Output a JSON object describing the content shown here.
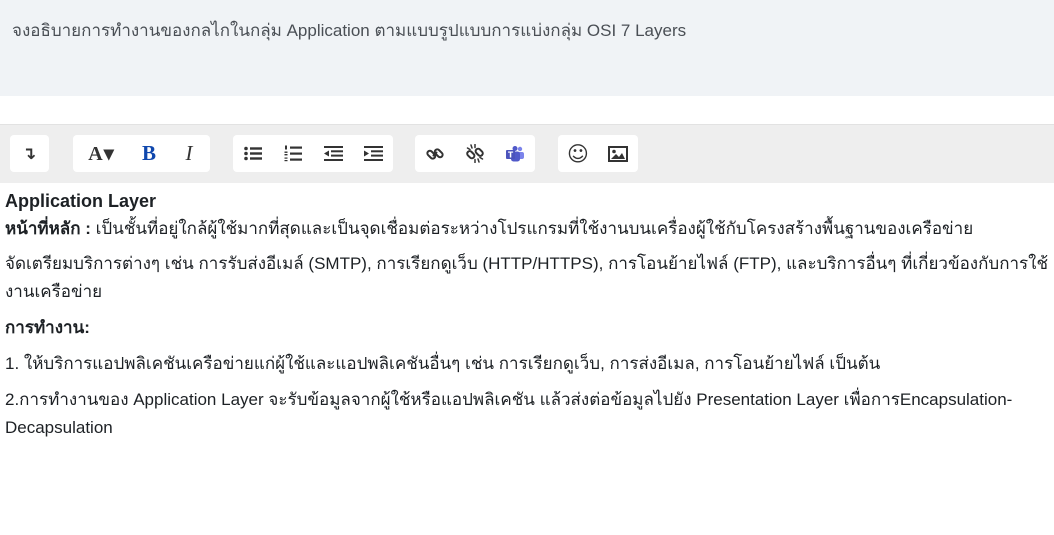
{
  "question": {
    "text": "จงอธิบายการทำงานของกลไกในกลุ่ม Application ตามแบบรูปแบบการแบ่งกลุ่ม OSI 7 Layers"
  },
  "toolbar": {
    "groups": [
      {
        "buttons": [
          {
            "icon": "collapse-arrow-icon",
            "glyph": "↴"
          }
        ]
      },
      {
        "buttons": [
          {
            "icon": "font-color-icon",
            "glyph": "A▾"
          },
          {
            "icon": "bold-icon",
            "glyph": "B"
          },
          {
            "icon": "italic-icon",
            "glyph": "I"
          }
        ]
      },
      {
        "buttons": [
          {
            "icon": "bullet-list-icon"
          },
          {
            "icon": "numbered-list-icon"
          },
          {
            "icon": "outdent-icon"
          },
          {
            "icon": "indent-icon"
          }
        ]
      },
      {
        "buttons": [
          {
            "icon": "link-icon"
          },
          {
            "icon": "unlink-icon"
          },
          {
            "icon": "teams-icon"
          }
        ]
      },
      {
        "buttons": [
          {
            "icon": "emoji-icon",
            "glyph": "☺"
          },
          {
            "icon": "image-icon"
          }
        ]
      }
    ],
    "colors": {
      "bold": "#0f47ad",
      "teams": "#5059c9"
    }
  },
  "answer": {
    "heading": "Application Layer",
    "role_label": "หน้าที่หลัก :",
    "role_text": " เป็นชั้นที่อยู่ใกล้ผู้ใช้มากที่สุดและเป็นจุดเชื่อมต่อระหว่างโปรแกรมที่ใช้งานบนเครื่องผู้ใช้กับโครงสร้างพื้นฐานของเครือข่าย",
    "services_text": "จัดเตรียมบริการต่างๆ เช่น การรับส่งอีเมล์ (SMTP), การเรียกดูเว็บ (HTTP/HTTPS), การโอนย้ายไฟล์ (FTP), และบริการอื่นๆ ที่เกี่ยวข้องกับการใช้งานเครือข่าย",
    "work_label": "การทำงาน:",
    "item1": "1. ให้บริการแอปพลิเคชันเครือข่ายแก่ผู้ใช้และแอปพลิเคชันอื่นๆ เช่น การเรียกดูเว็บ, การส่งอีเมล, การโอนย้ายไฟล์ เป็นต้น",
    "item2": "2.การทำงานของ Application Layer จะรับข้อมูลจากผู้ใช้หรือแอปพลิเคชัน แล้วส่งต่อข้อมูลไปยัง Presentation Layer เพื่อการEncapsulation-Decapsulation"
  }
}
